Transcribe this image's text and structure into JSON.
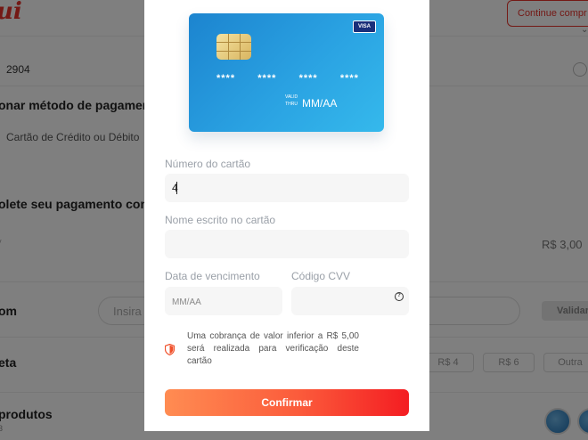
{
  "background": {
    "logo": "ui",
    "continue_button": "Continue compr",
    "code": "2904",
    "select_method_heading": "onar método de pagamen",
    "method_value": "Cartão de Crédito ou Débito",
    "complete_heading": "olete seu pagamento com",
    "small_label": "y",
    "price": "R$ 3,00",
    "coupon_label": "om",
    "coupon_placeholder": "Insira",
    "validate_button": "Validar",
    "tip_label": "eta",
    "tip_options": [
      "R$ 4",
      "R$ 6",
      "Outra"
    ],
    "products_label": "produtos",
    "products_sub": "3"
  },
  "card": {
    "brand": "VISA",
    "number_groups": [
      "****",
      "****",
      "****",
      "****"
    ],
    "valid_thru": [
      "VALID",
      "THRU"
    ],
    "expiry": "MM/AA"
  },
  "form": {
    "card_number_label": "Número do cartão",
    "card_number_value": "4",
    "name_label": "Nome escrito no cartão",
    "name_value": "",
    "expiry_label": "Data de vencimento",
    "expiry_placeholder": "MM/AA",
    "cvv_label": "Código CVV",
    "cvv_value": ""
  },
  "notice": "Uma cobrança de valor inferior a R$ 5,00 será realizada para verificação deste cartão",
  "confirm_button": "Confirmar",
  "colors": {
    "accent_start": "#ff8c52",
    "accent_end": "#f41d22",
    "card_blue": "#1c84cf",
    "brand_red": "#e8322a"
  }
}
